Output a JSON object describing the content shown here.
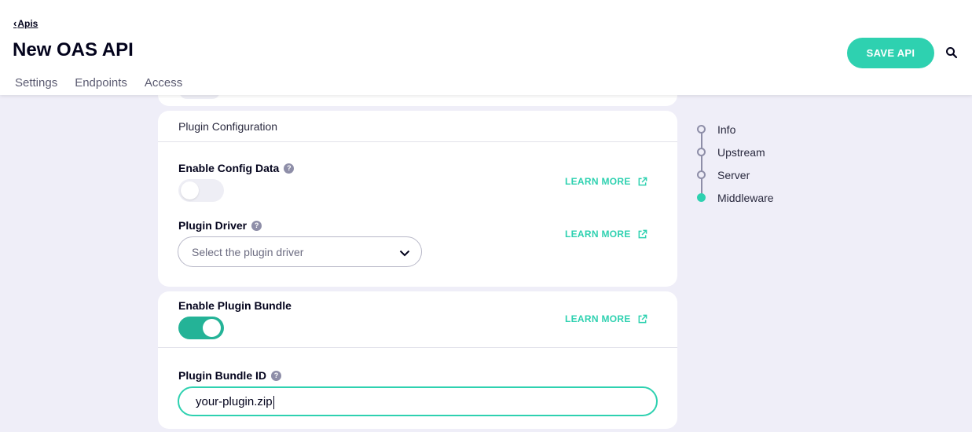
{
  "header": {
    "back_label": "Apis",
    "title": "New OAS API",
    "tabs": [
      {
        "label": "Settings"
      },
      {
        "label": "Endpoints"
      },
      {
        "label": "Access"
      }
    ],
    "save_label": "SAVE API",
    "search_icon": "search-icon"
  },
  "plugin_config": {
    "heading": "Plugin Configuration",
    "config_data": {
      "label": "Enable Config Data",
      "enabled": false,
      "learn_more": "LEARN MORE"
    },
    "driver": {
      "label": "Plugin Driver",
      "placeholder": "Select the plugin driver",
      "learn_more": "LEARN MORE"
    }
  },
  "plugin_bundle": {
    "enable": {
      "label": "Enable Plugin Bundle",
      "enabled": true,
      "learn_more": "LEARN MORE"
    },
    "bundle_id": {
      "label": "Plugin Bundle ID",
      "value": "your-plugin.zip"
    }
  },
  "stepper": {
    "items": [
      {
        "label": "Info",
        "active": false
      },
      {
        "label": "Upstream",
        "active": false
      },
      {
        "label": "Server",
        "active": false
      },
      {
        "label": "Middleware",
        "active": true
      }
    ]
  },
  "colors": {
    "accent": "#2ed1b0",
    "toggle_on": "#24b397",
    "background": "#efeef8",
    "muted": "#8e8ea8"
  }
}
